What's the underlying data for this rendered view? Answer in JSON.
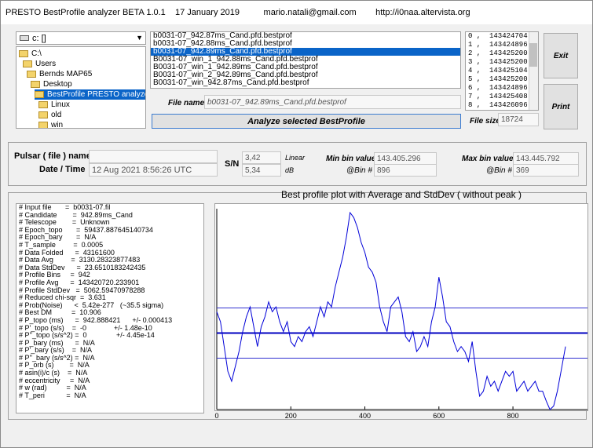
{
  "title_bar": "PRESTO BestProfile analyzer BETA 1.0.1    17 January 2019          mario.natali@gmail.com        http://i0naa.altervista.org",
  "drive": "c: []",
  "folders": [
    {
      "name": "C:\\",
      "indent": 0
    },
    {
      "name": "Users",
      "indent": 1
    },
    {
      "name": "Bernds MAP65",
      "indent": 2
    },
    {
      "name": "Desktop",
      "indent": 3
    },
    {
      "name": "BestProfile PRESTO analyzer 1.0.1.e",
      "indent": 4,
      "selected": true
    },
    {
      "name": "Linux",
      "indent": 5
    },
    {
      "name": "old",
      "indent": 5
    },
    {
      "name": "win",
      "indent": 5
    }
  ],
  "files": [
    "b0031-07_942.87ms_Cand.pfd.bestprof",
    "b0031-07_942.88ms_Cand.pfd.bestprof",
    "b0031-07_942.89ms_Cand.pfd.bestprof",
    "B0031-07_win_1_942.88ms_Cand.pfd.bestprof",
    "B0031-07_win_1_942.89ms_Cand.pfd.bestprof",
    "B0031-07_win_2_942.89ms_Cand.pfd.bestprof",
    "B0031-07_win_942.87ms_Cand.pfd.bestprof"
  ],
  "selected_file_index": 2,
  "bins": [
    "0 ,  143424704",
    "1 ,  143424896",
    "2 ,  143425200",
    "3 ,  143425200",
    "4 ,  143425104",
    "5 ,  143425200",
    "6 ,  143424896",
    "7 ,  143425408",
    "8 ,  143426096",
    "9 ,  143425792"
  ],
  "buttons": {
    "exit": "Exit",
    "print": "Print",
    "analyze": "Analyze selected BestProfile"
  },
  "file_name_label": "File name",
  "file_name_value": "b0031-07_942.89ms_Cand.pfd.bestprof",
  "file_size_label": "File size",
  "file_size_value": "18724",
  "pulsar_label": "Pulsar ( file ) name",
  "date_label": "Date / Time",
  "date_value": "12 Aug 2021     8:56:26  UTC",
  "sn_label": "S/N",
  "sn_linear": "3,42",
  "sn_linear_unit": "Linear",
  "sn_db": "5,34",
  "sn_db_unit": "dB",
  "min_label": "Min bin value",
  "min_value": "143.405.296",
  "min_bin_label": "@Bin #",
  "min_bin_value": "896",
  "max_label": "Max bin value",
  "max_value": "143.445.792",
  "max_bin_label": "@Bin #",
  "max_bin_value": "369",
  "info_lines": [
    "# Input file       =  b0031-07.fil",
    "# Candidate        =  942.89ms_Cand",
    "# Telescope        =  Unknown",
    "# Epoch_topo       =  59437.887645140734",
    "# Epoch_bary       =  N/A",
    "# T_sample         =  0.0005",
    "# Data Folded      =  43161600",
    "# Data Avg         =  3130.28323877483",
    "# Data StdDev      =  23.6510183242435",
    "# Profile Bins     =  942",
    "# Profile Avg      =  143420720.233901",
    "# Profile StdDev   =  5062.59470978288",
    "# Reduced chi-sqr  =  3.631",
    "# Prob(Noise)      <  5.42e-277   (~35.5 sigma)",
    "# Best DM          =  10.906",
    "# P_topo (ms)      =  942.888421      +/- 0.000413",
    "# P'_topo (s/s)    =  -0              +/- 1.48e-10",
    "# P''_topo (s/s^2) =  0               +/- 4.45e-14",
    "# P_bary (ms)      =  N/A",
    "# P'_bary (s/s)    =  N/A",
    "# P''_bary (s/s^2) =  N/A",
    "# P_orb (s)        =  N/A",
    "# asin(i)/c (s)    =  N/A",
    "# eccentricity     =  N/A",
    "# w (rad)          =  N/A",
    "# T_peri           =  N/A"
  ],
  "chart_data": {
    "type": "line",
    "title": "Best profile plot with  Average and StdDev ( without peak )",
    "xlim": [
      0,
      942
    ],
    "x_ticks": [
      0,
      200,
      400,
      600,
      800
    ],
    "ylim": [
      143405296,
      143445792
    ],
    "grid": false,
    "series": [
      {
        "x": [
          0,
          10,
          20,
          30,
          40,
          50,
          60,
          70,
          80,
          90,
          100,
          110,
          120,
          130,
          140,
          150,
          160,
          170,
          180,
          190,
          200,
          210,
          220,
          230,
          240,
          250,
          260,
          270,
          280,
          290,
          300,
          310,
          320,
          330,
          340,
          350,
          360,
          370,
          380,
          390,
          400,
          410,
          420,
          430,
          440,
          450,
          460,
          470,
          480,
          490,
          500,
          510,
          520,
          530,
          540,
          550,
          560,
          570,
          580,
          590,
          600,
          610,
          620,
          630,
          640,
          650,
          660,
          670,
          680,
          690,
          700,
          710,
          720,
          730,
          740,
          750,
          760,
          770,
          780,
          790,
          800,
          810,
          820,
          830,
          840,
          850,
          860,
          870,
          880,
          890,
          900,
          910,
          920,
          930,
          942
        ],
        "values": [
          143425000,
          143423000,
          143418000,
          143413000,
          143411000,
          143414000,
          143417000,
          143421000,
          143424000,
          143426000,
          143422000,
          143418000,
          143422000,
          143424000,
          143427000,
          143425000,
          143426000,
          143423000,
          143421000,
          143423000,
          143419000,
          143418000,
          143420000,
          143419000,
          143421000,
          143422000,
          143420000,
          143423000,
          143426000,
          143424000,
          143427000,
          143426000,
          143430000,
          143433000,
          143436000,
          143440000,
          143445000,
          143444000,
          143442000,
          143439000,
          143437000,
          143434000,
          143433000,
          143431000,
          143426000,
          143423000,
          143421000,
          143426000,
          143427000,
          143428000,
          143425000,
          143420000,
          143419000,
          143421000,
          143417000,
          143418000,
          143420000,
          143418000,
          143423000,
          143426000,
          143432000,
          143428000,
          143423000,
          143422000,
          143419000,
          143417000,
          143418000,
          143417000,
          143415000,
          143419000,
          143413000,
          143408000,
          143409000,
          143412000,
          143410000,
          143411000,
          143409000,
          143411000,
          143413000,
          143412000,
          143413000,
          143409000,
          143410000,
          143411000,
          143409000,
          143410000,
          143411000,
          143409000,
          143409000,
          143407000,
          143405296,
          143406000,
          143409000,
          143413000,
          143418000
        ]
      }
    ],
    "average": 143420720,
    "stddev": 5062
  }
}
